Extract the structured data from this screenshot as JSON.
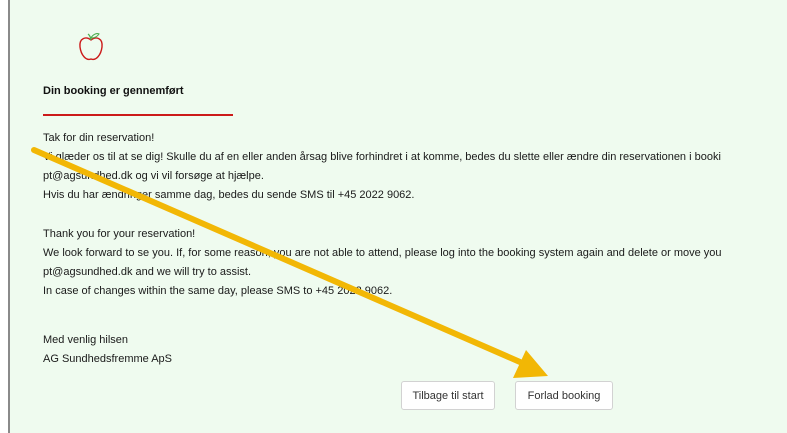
{
  "confirmation": {
    "title": "Din booking er gennemført",
    "danish_lines": [
      "Tak for din reservation!",
      "Vi glæder os til at se dig! Skulle du af en eller anden årsag blive forhindret i at komme, bedes du slette eller ændre din reservationen i booki",
      "pt@agsundhed.dk og vi vil forsøge at hjælpe.",
      "Hvis du har ændringer samme dag, bedes du sende SMS til +45 2022 9062."
    ],
    "english_lines": [
      "Thank you for your reservation!",
      "We look forward to se you. If, for some reason, you are not able to attend, please log into the booking system again and delete or move you",
      "pt@agsundhed.dk and we will try to assist.",
      "In case of changes within the same day, please SMS to +45 2022 9062."
    ],
    "signoff_lines": [
      "Med venlig hilsen",
      "AG Sundhedsfremme ApS"
    ]
  },
  "buttons": {
    "back_label": "Tilbage til start",
    "leave_label": "Forlad booking"
  },
  "colors": {
    "panel_background": "#effbef",
    "title_underline": "#cc1a1a",
    "annotation_arrow": "#f2b705",
    "logo_apple": "#cc1a1a",
    "logo_leaf": "#4caf50"
  },
  "icons": {
    "logo": "apple-icon",
    "annotation": "arrow-annotation"
  }
}
